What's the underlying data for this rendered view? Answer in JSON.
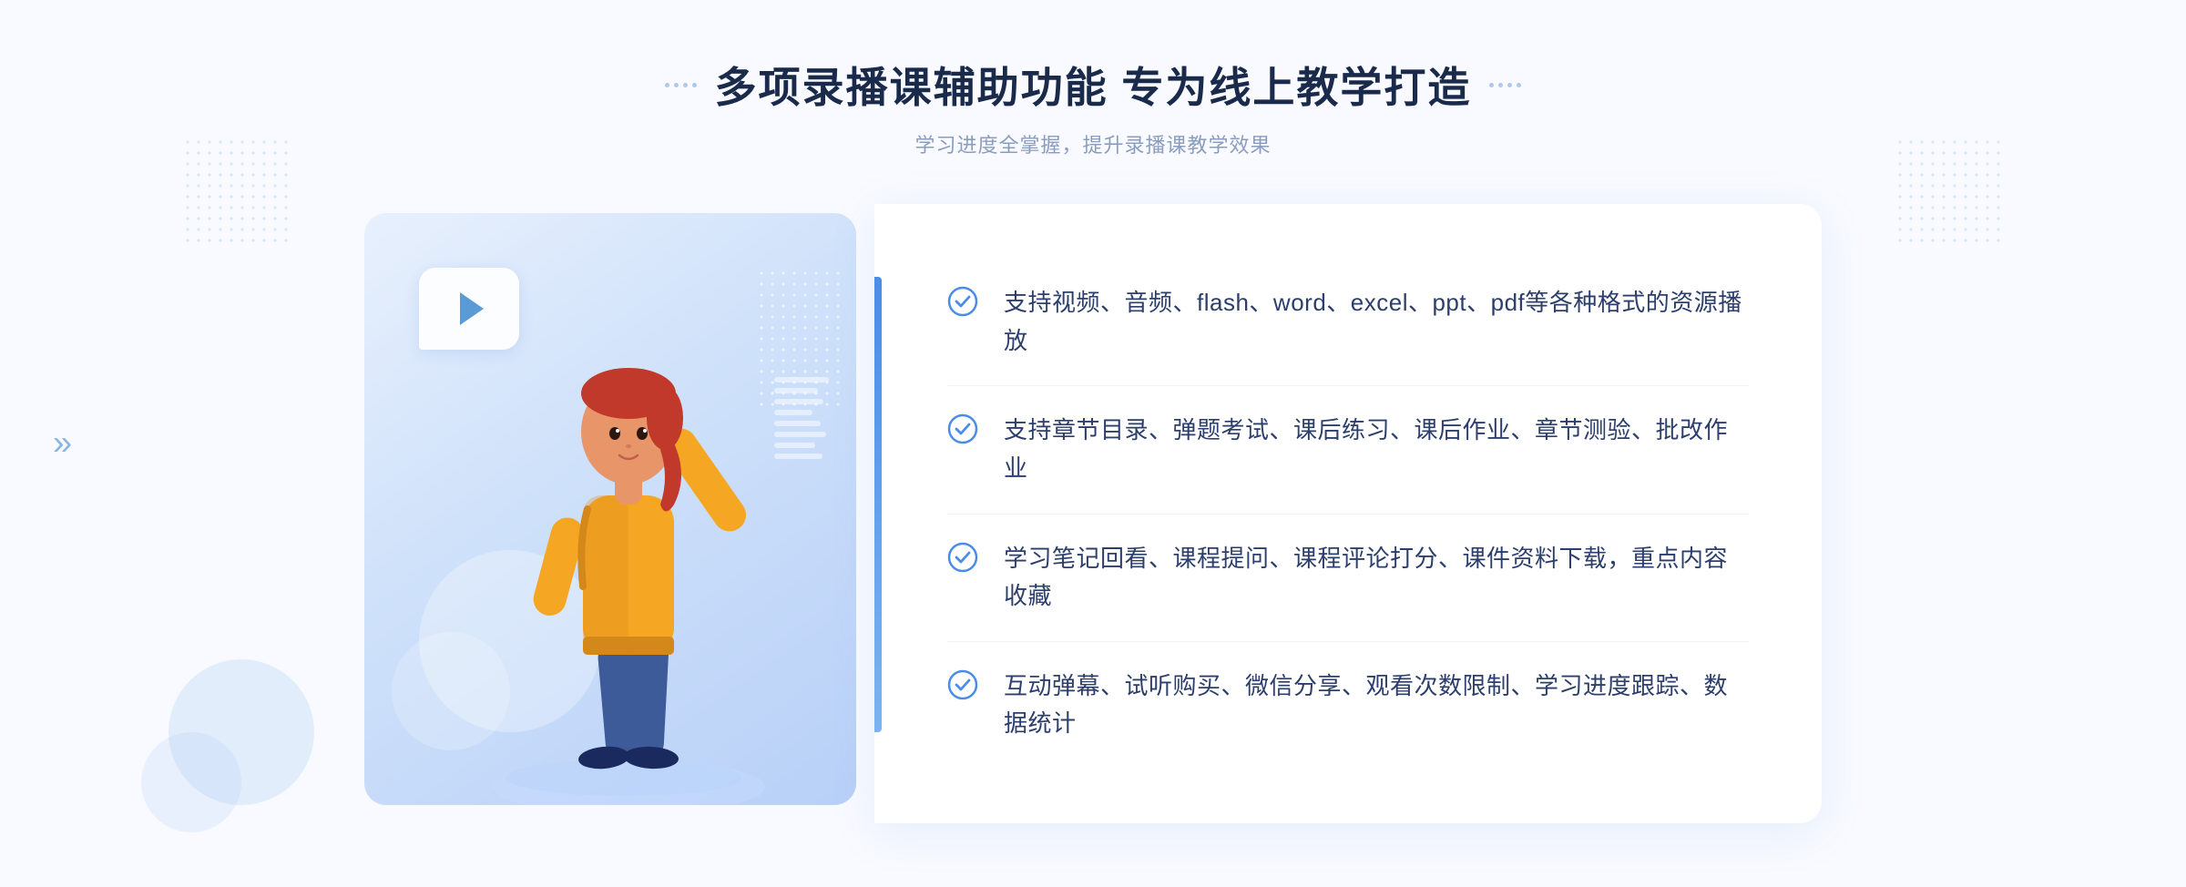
{
  "page": {
    "background": "#f8faff"
  },
  "header": {
    "title": "多项录播课辅助功能 专为线上教学打造",
    "subtitle": "学习进度全掌握，提升录播课教学效果"
  },
  "features": [
    {
      "id": 1,
      "text": "支持视频、音频、flash、word、excel、ppt、pdf等各种格式的资源播放"
    },
    {
      "id": 2,
      "text": "支持章节目录、弹题考试、课后练习、课后作业、章节测验、批改作业"
    },
    {
      "id": 3,
      "text": "学习笔记回看、课程提问、课程评论打分、课件资料下载，重点内容收藏"
    },
    {
      "id": 4,
      "text": "互动弹幕、试听购买、微信分享、观看次数限制、学习进度跟踪、数据统计"
    }
  ],
  "icons": {
    "check": "check-circle-icon",
    "play": "play-icon",
    "chevron": "chevron-left-icon"
  }
}
